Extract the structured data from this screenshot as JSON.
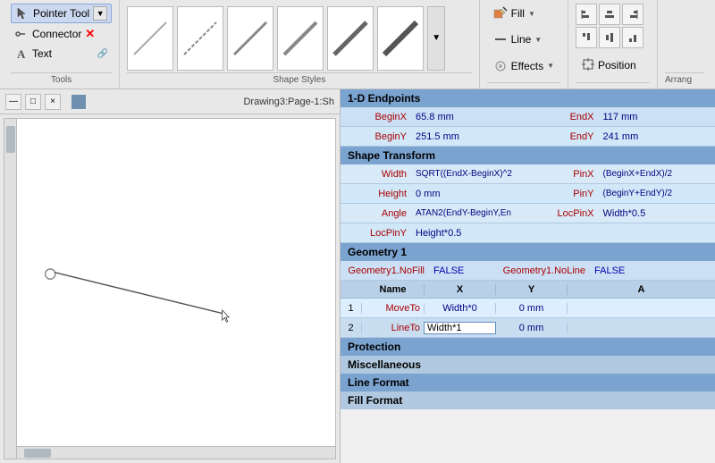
{
  "toolbar": {
    "tools": {
      "label": "Tools",
      "pointer_tool": "Pointer Tool",
      "connector": "Connector",
      "text": "Text"
    },
    "shape_styles": {
      "label": "Shape Styles"
    },
    "fill_btn": "Fill",
    "line_btn": "Line",
    "effects_btn": "Effects",
    "align_btn": "Align",
    "position_btn": "Position",
    "arrange_label": "Arrang"
  },
  "titlebar": {
    "minimize": "—",
    "restore": "□",
    "close": "×",
    "title": "Drawing3:Page-1:Sh"
  },
  "properties": {
    "endpoints_header": "1-D Endpoints",
    "beginx_label": "BeginX",
    "beginx_value": "65.8 mm",
    "endx_label": "EndX",
    "endx_value": "117 mm",
    "beginy_label": "BeginY",
    "beginy_value": "251.5 mm",
    "endy_label": "EndY",
    "endy_value": "241 mm",
    "transform_header": "Shape Transform",
    "width_label": "Width",
    "width_value": "SQRT((EndX-BeginX)^2",
    "pinx_label": "PinX",
    "pinx_value": "(BeginX+EndX)/2",
    "height_label": "Height",
    "height_value": "0 mm",
    "piny_label": "PinY",
    "piny_value": "(BeginY+EndY)/2",
    "angle_label": "Angle",
    "angle_value": "ATAN2(EndY-BeginY,En",
    "locpinx_label": "LocPinX",
    "locpinx_value": "Width*0.5",
    "locpiny_label": "LocPinY",
    "locpiny_value": "Height*0.5",
    "geometry1_header": "Geometry 1",
    "geo1_nofill_label": "Geometry1.NoFill",
    "geo1_nofill_value": "FALSE",
    "geo1_noline_label": "Geometry1.NoLine",
    "geo1_noline_value": "FALSE",
    "table_headers": {
      "name": "Name",
      "x": "X",
      "y": "Y",
      "a": "A"
    },
    "table_rows": [
      {
        "idx": "1",
        "name": "MoveTo",
        "x": "Width*0",
        "y": "0 mm",
        "a": ""
      },
      {
        "idx": "2",
        "name": "LineTo",
        "x": "Width*1",
        "y": "0 mm",
        "a": ""
      }
    ],
    "protection_header": "Protection",
    "miscellaneous_header": "Miscellaneous",
    "line_format_header": "Line Format",
    "fill_format_header": "Fill Format"
  }
}
